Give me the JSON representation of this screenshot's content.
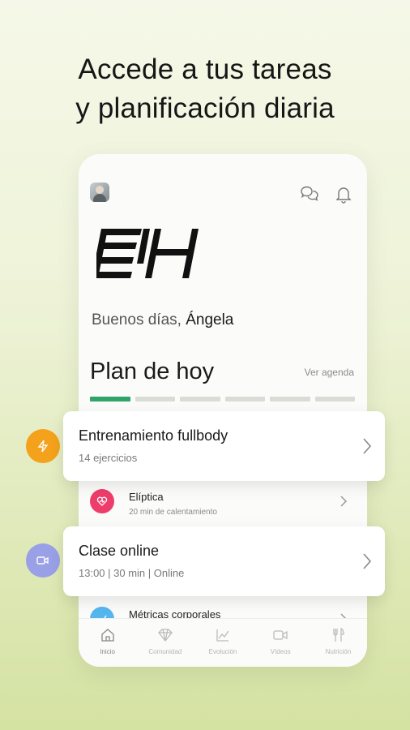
{
  "headline": {
    "line1": "Accede a tus tareas",
    "line2": "y planificación diaria"
  },
  "app": {
    "greeting_prefix": "Buenos días,",
    "greeting_name": "Ángela",
    "plan_title": "Plan de hoy",
    "agenda_link": "Ver agenda",
    "progress": {
      "completed": 1,
      "total": 6
    }
  },
  "cards": [
    {
      "title": "Entrenamiento fullbody",
      "subtitle": "14 ejercicios",
      "icon": "lightning-icon",
      "color": "#f4a21b"
    },
    {
      "title": "Clase online",
      "subtitle": "13:00 | 30 min | Online",
      "icon": "video-icon",
      "color": "#9aa0e6"
    }
  ],
  "list_items": [
    {
      "title": "Elíptica",
      "subtitle": "20 min de calentamiento",
      "icon": "heart-icon",
      "color": "#ee3d6b"
    },
    {
      "title": "Métricas corporales",
      "icon": "metrics-icon",
      "color": "#55b6ee"
    }
  ],
  "tabs": [
    {
      "label": "Inicio",
      "icon": "home-icon",
      "active": true
    },
    {
      "label": "Comunidad",
      "icon": "diamond-icon",
      "active": false
    },
    {
      "label": "Evolución",
      "icon": "chart-icon",
      "active": false
    },
    {
      "label": "Vídeos",
      "icon": "video-icon",
      "active": false
    },
    {
      "label": "Nutrición",
      "icon": "cutlery-icon",
      "active": false
    }
  ],
  "colors": {
    "accent": "#2ea36a",
    "background": "#e8efcb"
  }
}
